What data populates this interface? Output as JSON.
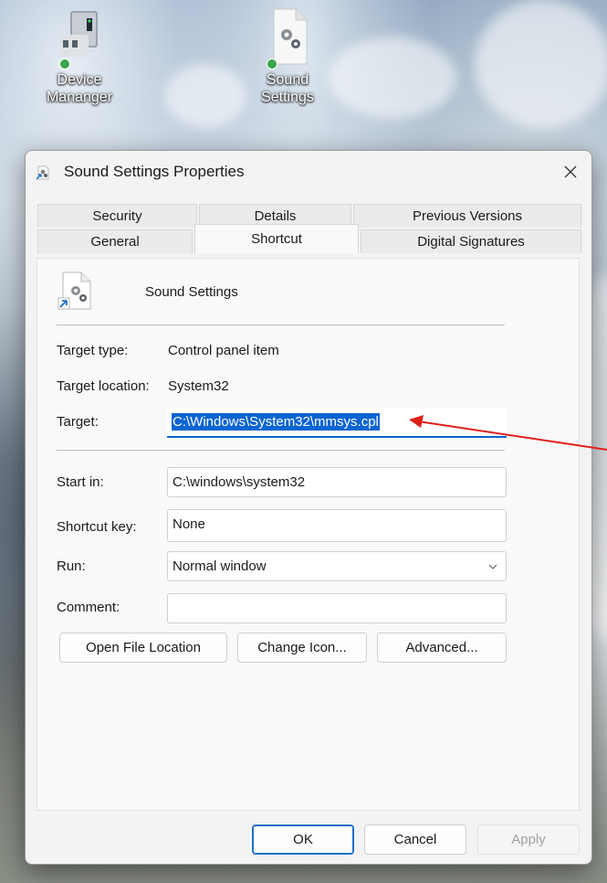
{
  "desktop": {
    "icons": [
      {
        "label_line1": "Device",
        "label_line2": "Mananger"
      },
      {
        "label_line1": "Sound",
        "label_line2": "Settings"
      }
    ]
  },
  "dialog": {
    "title": "Sound Settings Properties",
    "tabs_back": [
      "Security",
      "Details",
      "Previous Versions"
    ],
    "tabs_front": [
      "General",
      "Shortcut",
      "Digital Signatures"
    ],
    "active_tab": "Shortcut",
    "shortcut_name": "Sound Settings",
    "target_type_label": "Target type:",
    "target_type_value": "Control panel item",
    "target_location_label": "Target location:",
    "target_location_value": "System32",
    "target_label": "Target:",
    "target_value": "C:\\Windows\\System32\\mmsys.cpl",
    "start_in_label": "Start in:",
    "start_in_value": "C:\\windows\\system32",
    "shortcut_key_label": "Shortcut key:",
    "shortcut_key_value": "None",
    "run_label": "Run:",
    "run_value": "Normal window",
    "comment_label": "Comment:",
    "comment_value": "",
    "buttons": {
      "open_file_location": "Open File Location",
      "change_icon": "Change Icon...",
      "advanced": "Advanced...",
      "ok": "OK",
      "cancel": "Cancel",
      "apply": "Apply"
    }
  },
  "colors": {
    "selection": "#0a64d1",
    "arrow": "#e0201b",
    "dialog_bg": "#f3f3f3"
  }
}
